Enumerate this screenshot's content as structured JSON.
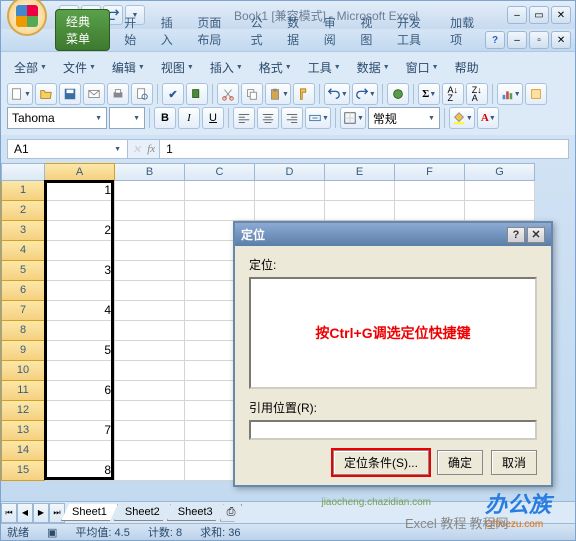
{
  "title": "Book1 [兼容模式] - Microsoft Excel",
  "tabs": {
    "classic": "经典菜单",
    "home": "开始",
    "insert": "插入",
    "layout": "页面布局",
    "formula": "公式",
    "data": "数据",
    "review": "审阅",
    "view": "视图",
    "dev": "开发工具",
    "addin": "加载项"
  },
  "menu": {
    "all": "全部",
    "file": "文件",
    "edit": "编辑",
    "view": "视图",
    "insert": "插入",
    "format": "格式",
    "tools": "工具",
    "data": "数据",
    "window": "窗口",
    "help": "帮助"
  },
  "font": {
    "name": "Tahoma",
    "size": "",
    "style": "常规"
  },
  "namebox": "A1",
  "formula_value": "1",
  "columns": [
    "A",
    "B",
    "C",
    "D",
    "E",
    "F",
    "G"
  ],
  "cells": {
    "1": "1",
    "2": "",
    "3": "2",
    "4": "",
    "5": "3",
    "6": "",
    "7": "4",
    "8": "",
    "9": "5",
    "10": "",
    "11": "6",
    "12": "",
    "13": "7",
    "14": "",
    "15": "8"
  },
  "sheets": [
    "Sheet1",
    "Sheet2",
    "Sheet3"
  ],
  "status": {
    "ready": "就绪",
    "avg_label": "平均值:",
    "avg": "4.5",
    "count_label": "计数:",
    "count": "8",
    "sum_label": "求和:",
    "sum": "36"
  },
  "dialog": {
    "title": "定位",
    "goto_label": "定位:",
    "note": "按Ctrl+G调选定位快捷键",
    "ref_label": "引用位置(R):",
    "ref_value": "",
    "special": "定位条件(S)...",
    "ok": "确定",
    "cancel": "取消"
  },
  "watermark": {
    "main": "办公族",
    "sub": "Officezu.com",
    "edu": "Excel 教程",
    "note": "jiaocheng.chazidian.com",
    "extra": "教程网"
  }
}
